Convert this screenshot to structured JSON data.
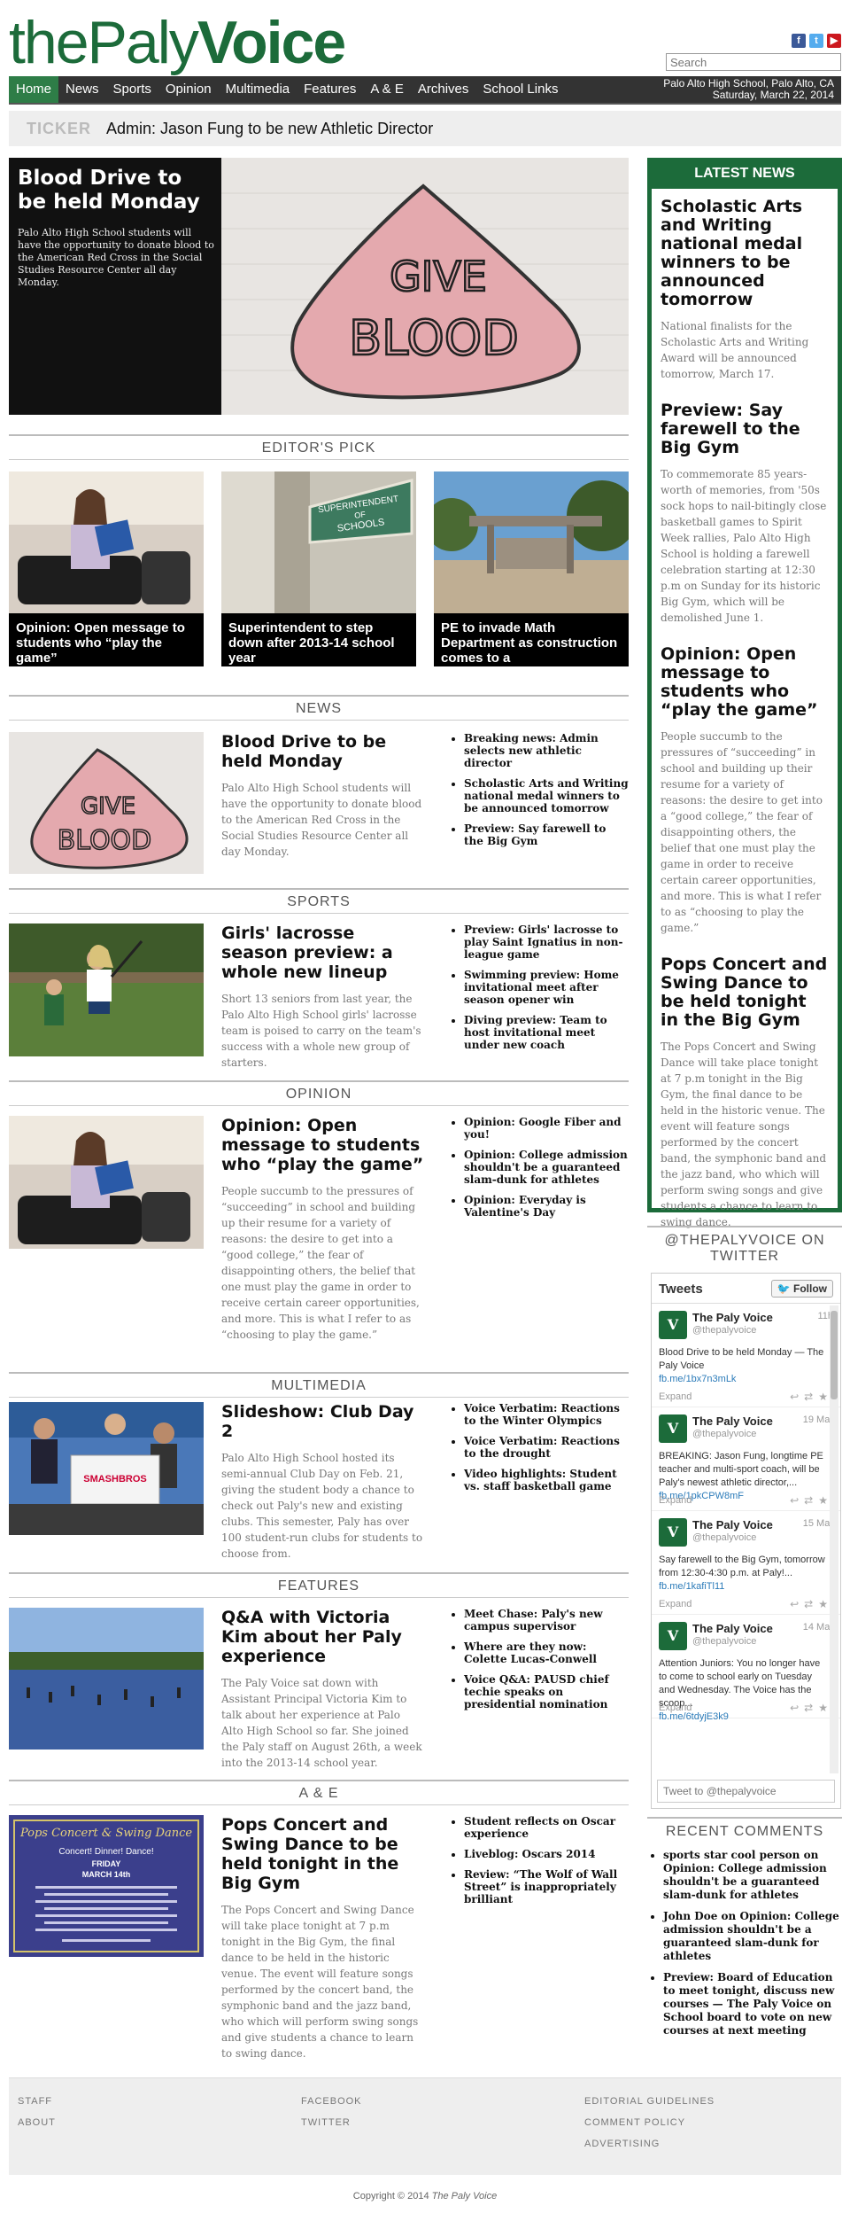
{
  "site": {
    "logo_thin": "the",
    "logo_bold": "Paly",
    "logo_end": "Voice",
    "search_placeholder": "Search",
    "location": "Palo Alto High School, Palo Alto, CA",
    "date": "Saturday, March 22, 2014",
    "social": [
      "facebook-icon",
      "twitter-icon",
      "youtube-icon"
    ]
  },
  "nav": {
    "items": [
      "Home",
      "News",
      "Sports",
      "Opinion",
      "Multimedia",
      "Features",
      "A & E",
      "Archives",
      "School Links"
    ]
  },
  "ticker": {
    "label": "TICKER",
    "text": "Admin: Jason Fung to be new Athletic Director"
  },
  "hero": {
    "title": "Blood Drive to be held Monday",
    "desc": "Palo Alto High School students will have the opportunity to donate blood to the American Red Cross in the Social Studies Resource Center all day Monday.",
    "img_text_1": "GIVE",
    "img_text_2": "BLOOD"
  },
  "editors_pick": {
    "heading": "EDITOR'S PICK",
    "items": [
      {
        "caption": "Opinion: Open message to students who “play the game”"
      },
      {
        "caption": "Superintendent to step down after 2013-14 school year",
        "sign_1": "SUPERINTENDENT",
        "sign_2": "OF",
        "sign_3": "SCHOOLS"
      },
      {
        "caption": "PE to invade Math Department as construction comes to a"
      }
    ]
  },
  "sections": {
    "news": {
      "heading": "NEWS",
      "title": "Blood Drive to be held Monday",
      "desc": "Palo Alto High School students will have the opportunity to donate blood to the American Red Cross in the Social Studies Resource Center all day Monday.",
      "bullets": [
        "Breaking news: Admin selects new athletic director",
        "Scholastic Arts and Writing national medal winners to be announced tomorrow",
        "Preview: Say farewell to the Big Gym"
      ]
    },
    "sports": {
      "heading": "SPORTS",
      "title": "Girls' lacrosse season preview: a whole new lineup",
      "desc": "Short 13 seniors from last year, the Palo Alto High School girls' lacrosse team is poised to carry on the team's success with a whole new group of starters.",
      "bullets": [
        "Preview: Girls' lacrosse to play Saint Ignatius in non-league game",
        "Swimming preview: Home invitational meet after season opener win",
        "Diving preview: Team to host invitational meet under new coach"
      ]
    },
    "opinion": {
      "heading": "OPINION",
      "title": "Opinion: Open message to students who “play the game”",
      "desc": "People succumb to the pressures of “succeeding” in school and building up their resume for a variety of reasons: the desire to get into a “good college,” the fear of disappointing others, the belief that one must play the game in order to receive certain career opportunities, and more. This is what I refer to as “choosing to play the game.”",
      "bullets": [
        "Opinion: Google Fiber and you!",
        "Opinion: College admission shouldn't be a guaranteed slam-dunk for athletes",
        "Opinion: Everyday is Valentine's Day"
      ]
    },
    "multimedia": {
      "heading": "MULTIMEDIA",
      "title": "Slideshow: Club Day 2",
      "desc": "Palo Alto High School hosted its semi-annual Club Day on Feb. 21, giving the student body a chance to check out Paly's new and existing clubs. This semester, Paly has over 100 student-run clubs for students to choose from.",
      "bullets": [
        "Voice Verbatim: Reactions to the Winter Olympics",
        "Voice Verbatim: Reactions to the drought",
        "Video highlights: Student vs. staff basketball game"
      ],
      "sign_text": "SMASHBROS"
    },
    "features": {
      "heading": "FEATURES",
      "title": "Q&A with Victoria Kim about her Paly experience",
      "desc": "The Paly Voice sat down with Assistant Principal Victoria Kim to talk about her experience at Palo Alto High School so far. She joined the Paly staff on August 26th, a week into the 2013-14 school year.",
      "bullets": [
        "Meet Chase: Paly's new campus supervisor",
        "Where are they now: Colette Lucas-Conwell",
        "Voice Q&A: PAUSD chief techie speaks on presidential nomination"
      ]
    },
    "ae": {
      "heading": "A & E",
      "title": "Pops Concert and Swing Dance to be held tonight in the Big Gym",
      "desc": "The Pops Concert and Swing Dance will take place tonight at 7 p.m tonight in the Big Gym, the final dance to be held in the historic venue. The event will feature songs performed by the concert band, the symphonic band and the jazz band, who which will perform swing songs and give students a chance to learn to swing dance.",
      "bullets": [
        "Student reflects on Oscar experience",
        "Liveblog: Oscars 2014",
        "Review: “The Wolf of Wall Street” is inappropriately brilliant"
      ],
      "poster_title": "Pops Concert & Swing Dance",
      "poster_sub": "Concert! Dinner! Dance!",
      "poster_day": "FRIDAY",
      "poster_date": "MARCH 14th"
    }
  },
  "latest": {
    "heading": "LATEST NEWS",
    "items": [
      {
        "title": "Scholastic Arts and Writing national medal winners to be announced tomorrow",
        "desc": "National finalists for the Scholastic Arts and Writing Award will be announced tomorrow, March 17."
      },
      {
        "title": "Preview: Say farewell to the Big Gym",
        "desc": "To commemorate 85 years-worth of memories, from '50s sock hops to nail-bitingly close basketball games to Spirit Week rallies, Palo Alto High School is holding a farewell celebration starting at 12:30 p.m on Sunday for its historic Big Gym, which will be demolished June 1."
      },
      {
        "title": "Opinion: Open message to students who “play the game”",
        "desc": "People succumb to the pressures of “succeeding” in school and building up their resume for a variety of reasons: the desire to get into a “good college,” the fear of disappointing others, the belief that one must play the game in order to receive certain career opportunities, and more. This is what I refer to as “choosing to play the game.”"
      },
      {
        "title": "Pops Concert and Swing Dance to be held tonight in the Big Gym",
        "desc": "The Pops Concert and Swing Dance will take place tonight at 7 p.m tonight in the Big Gym, the final dance to be held in the historic venue. The event will feature songs performed by the concert band, the symphonic band and the jazz band, who which will perform swing songs and give students a chance to learn to swing dance."
      }
    ]
  },
  "twitter": {
    "heading": "@THEPALYVOICE ON TWITTER",
    "widget_title": "Tweets",
    "follow": "Follow",
    "tweets": [
      {
        "name": "The Paly Voice",
        "handle": "@thepalyvoice",
        "time": "11h",
        "text": "Blood Drive to be held Monday — The Paly Voice",
        "link": "fb.me/1bx7n3mLk",
        "expand": "Expand"
      },
      {
        "name": "The Paly Voice",
        "handle": "@thepalyvoice",
        "time": "19 Mar",
        "text": "BREAKING: Jason Fung, longtime PE teacher and multi-sport coach, will be Paly's newest athletic director,...",
        "link": "fb.me/1pkCPW8mF",
        "expand": "Expand"
      },
      {
        "name": "The Paly Voice",
        "handle": "@thepalyvoice",
        "time": "15 Mar",
        "text": "Say farewell to the Big Gym, tomorrow from 12:30-4:30 p.m. at Paly!...",
        "link": "fb.me/1kafiTl11",
        "expand": "Expand"
      },
      {
        "name": "The Paly Voice",
        "handle": "@thepalyvoice",
        "time": "14 Mar",
        "text": "Attention Juniors: You no longer have to come to school early on Tuesday and Wednesday. The Voice has the scoop...",
        "link": "fb.me/6tdyjE3k9",
        "expand": "Expand"
      }
    ],
    "input_placeholder": "Tweet to @thepalyvoice"
  },
  "recent_comments": {
    "heading": "RECENT COMMENTS",
    "items": [
      "sports star cool person on Opinion: College admission shouldn't be a guaranteed slam-dunk for athletes",
      "John Doe on Opinion: College admission shouldn't be a guaranteed slam-dunk for athletes",
      "Preview: Board of Education to meet tonight, discuss new courses — The Paly Voice on School board to vote on new courses at next meeting"
    ]
  },
  "footer": {
    "col1": [
      "STAFF",
      "ABOUT"
    ],
    "col2": [
      "FACEBOOK",
      "TWITTER"
    ],
    "col3": [
      "EDITORIAL GUIDELINES",
      "COMMENT POLICY",
      "ADVERTISING"
    ],
    "copyright_prefix": "Copyright © 2014",
    "copyright_name": "The Paly Voice"
  },
  "colors": {
    "brand_green": "#1c6b3a",
    "nav_bg": "#333333",
    "active_tab": "#2e7d47"
  }
}
